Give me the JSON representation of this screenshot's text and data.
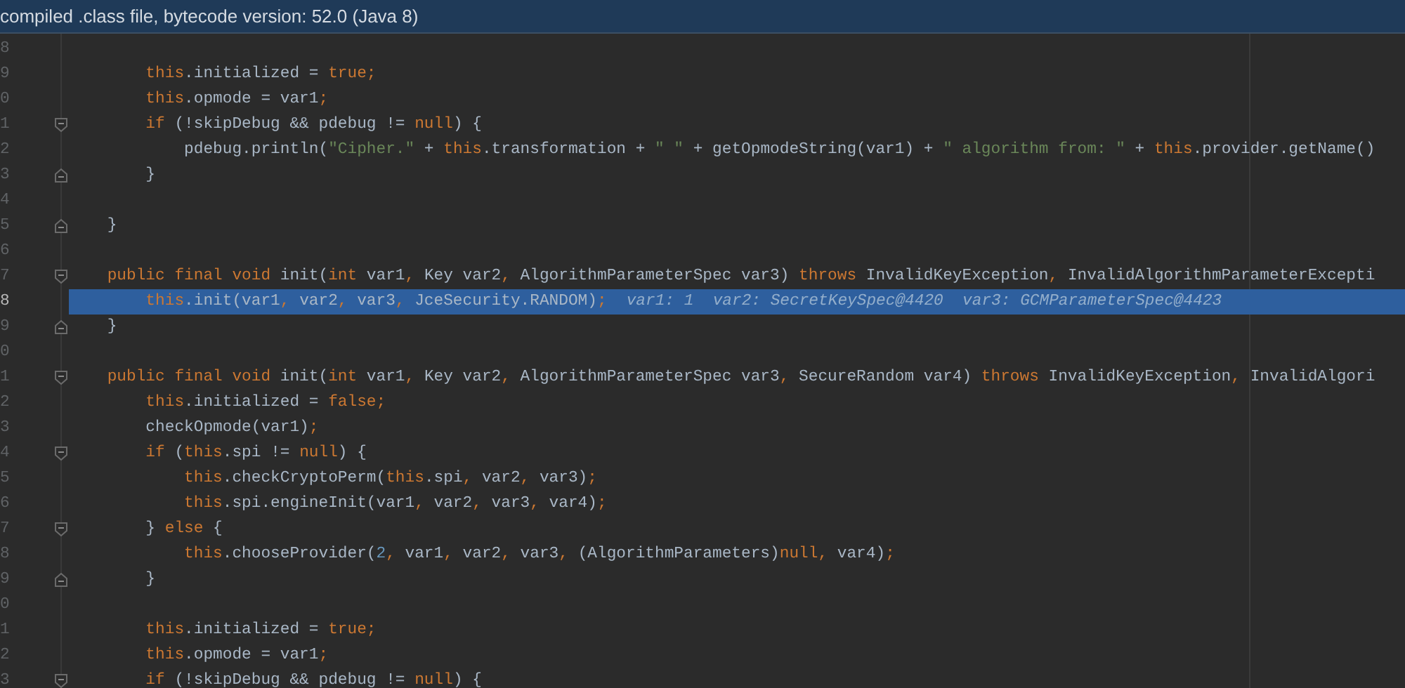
{
  "title_bar": {
    "text": "compiled .class file, bytecode version: 52.0 (Java 8)"
  },
  "lines": [
    {
      "number": "8",
      "selected": false
    },
    {
      "number": "9",
      "selected": false,
      "tokens": [
        {
          "kind": "kw",
          "text": "        this"
        },
        {
          "kind": "plain",
          "text": ".initialized = "
        },
        {
          "kind": "kw",
          "text": "true;"
        }
      ]
    },
    {
      "number": "0",
      "selected": false,
      "tokens": [
        {
          "kind": "kw",
          "text": "        this"
        },
        {
          "kind": "plain",
          "text": ".opmode = var1"
        },
        {
          "kind": "kw",
          "text": ";"
        }
      ]
    },
    {
      "number": "1",
      "selected": false,
      "fold": {
        "kind": "open"
      },
      "tokens": [
        {
          "kind": "kw",
          "text": "        if"
        },
        {
          "kind": "plain",
          "text": " (!skipDebug && pdebug != "
        },
        {
          "kind": "kw",
          "text": "null"
        },
        {
          "kind": "plain",
          "text": ") {"
        }
      ]
    },
    {
      "number": "2",
      "selected": false,
      "tokens": [
        {
          "kind": "plain",
          "text": "            pdebug.println("
        },
        {
          "kind": "str",
          "text": "\"Cipher.\""
        },
        {
          "kind": "plain",
          "text": " + "
        },
        {
          "kind": "kw",
          "text": "this"
        },
        {
          "kind": "plain",
          "text": ".transformation + "
        },
        {
          "kind": "str",
          "text": "\" \""
        },
        {
          "kind": "plain",
          "text": " + getOpmodeString(var1) + "
        },
        {
          "kind": "str",
          "text": "\" algorithm from: \""
        },
        {
          "kind": "plain",
          "text": " + "
        },
        {
          "kind": "kw",
          "text": "this"
        },
        {
          "kind": "plain",
          "text": ".provider.getName()"
        }
      ]
    },
    {
      "number": "3",
      "selected": false,
      "fold": {
        "kind": "close"
      },
      "tokens": [
        {
          "kind": "plain",
          "text": "        }"
        }
      ]
    },
    {
      "number": "4",
      "selected": false
    },
    {
      "number": "5",
      "selected": false,
      "fold": {
        "kind": "close"
      },
      "tokens": [
        {
          "kind": "plain",
          "text": "    }"
        }
      ]
    },
    {
      "number": "6",
      "selected": false
    },
    {
      "number": "7",
      "selected": false,
      "fold": {
        "kind": "open"
      },
      "tokens": [
        {
          "kind": "kw",
          "text": "    public final void "
        },
        {
          "kind": "plain",
          "text": "init("
        },
        {
          "kind": "kw",
          "text": "int "
        },
        {
          "kind": "plain",
          "text": "var1"
        },
        {
          "kind": "kw",
          "text": ", "
        },
        {
          "kind": "plain",
          "text": "Key var2"
        },
        {
          "kind": "kw",
          "text": ", "
        },
        {
          "kind": "plain",
          "text": "AlgorithmParameterSpec var3) "
        },
        {
          "kind": "kw",
          "text": "throws "
        },
        {
          "kind": "plain",
          "text": "InvalidKeyException"
        },
        {
          "kind": "kw",
          "text": ", "
        },
        {
          "kind": "plain",
          "text": "InvalidAlgorithmParameterExcepti"
        }
      ]
    },
    {
      "number": "8",
      "selected": true,
      "tokens": [
        {
          "kind": "kw",
          "text": "        this"
        },
        {
          "kind": "plain",
          "text": ".init(var1"
        },
        {
          "kind": "kw",
          "text": ", "
        },
        {
          "kind": "plain",
          "text": "var2"
        },
        {
          "kind": "kw",
          "text": ", "
        },
        {
          "kind": "plain",
          "text": "var3"
        },
        {
          "kind": "kw",
          "text": ", "
        },
        {
          "kind": "plain",
          "text": "JceSecurity.RANDOM)"
        },
        {
          "kind": "kw",
          "text": ";"
        }
      ],
      "inline_values": "var1: 1  var2: SecretKeySpec@4420  var3: GCMParameterSpec@4423"
    },
    {
      "number": "9",
      "selected": false,
      "fold": {
        "kind": "close"
      },
      "tokens": [
        {
          "kind": "plain",
          "text": "    }"
        }
      ]
    },
    {
      "number": "0",
      "selected": false
    },
    {
      "number": "1",
      "selected": false,
      "fold": {
        "kind": "open"
      },
      "tokens": [
        {
          "kind": "kw",
          "text": "    public final void "
        },
        {
          "kind": "plain",
          "text": "init("
        },
        {
          "kind": "kw",
          "text": "int "
        },
        {
          "kind": "plain",
          "text": "var1"
        },
        {
          "kind": "kw",
          "text": ", "
        },
        {
          "kind": "plain",
          "text": "Key var2"
        },
        {
          "kind": "kw",
          "text": ", "
        },
        {
          "kind": "plain",
          "text": "AlgorithmParameterSpec var3"
        },
        {
          "kind": "kw",
          "text": ", "
        },
        {
          "kind": "plain",
          "text": "SecureRandom var4) "
        },
        {
          "kind": "kw",
          "text": "throws "
        },
        {
          "kind": "plain",
          "text": "InvalidKeyException"
        },
        {
          "kind": "kw",
          "text": ", "
        },
        {
          "kind": "plain",
          "text": "InvalidAlgori"
        }
      ]
    },
    {
      "number": "2",
      "selected": false,
      "tokens": [
        {
          "kind": "kw",
          "text": "        this"
        },
        {
          "kind": "plain",
          "text": ".initialized = "
        },
        {
          "kind": "kw",
          "text": "false;"
        }
      ]
    },
    {
      "number": "3",
      "selected": false,
      "tokens": [
        {
          "kind": "plain",
          "text": "        checkOpmode(var1)"
        },
        {
          "kind": "kw",
          "text": ";"
        }
      ]
    },
    {
      "number": "4",
      "selected": false,
      "fold": {
        "kind": "open"
      },
      "tokens": [
        {
          "kind": "kw",
          "text": "        if "
        },
        {
          "kind": "plain",
          "text": "("
        },
        {
          "kind": "kw",
          "text": "this"
        },
        {
          "kind": "plain",
          "text": ".spi != "
        },
        {
          "kind": "kw",
          "text": "null"
        },
        {
          "kind": "plain",
          "text": ") {"
        }
      ]
    },
    {
      "number": "5",
      "selected": false,
      "tokens": [
        {
          "kind": "kw",
          "text": "            this"
        },
        {
          "kind": "plain",
          "text": ".checkCryptoPerm("
        },
        {
          "kind": "kw",
          "text": "this"
        },
        {
          "kind": "plain",
          "text": ".spi"
        },
        {
          "kind": "kw",
          "text": ", "
        },
        {
          "kind": "plain",
          "text": "var2"
        },
        {
          "kind": "kw",
          "text": ", "
        },
        {
          "kind": "plain",
          "text": "var3)"
        },
        {
          "kind": "kw",
          "text": ";"
        }
      ]
    },
    {
      "number": "6",
      "selected": false,
      "tokens": [
        {
          "kind": "kw",
          "text": "            this"
        },
        {
          "kind": "plain",
          "text": ".spi.engineInit(var1"
        },
        {
          "kind": "kw",
          "text": ", "
        },
        {
          "kind": "plain",
          "text": "var2"
        },
        {
          "kind": "kw",
          "text": ", "
        },
        {
          "kind": "plain",
          "text": "var3"
        },
        {
          "kind": "kw",
          "text": ", "
        },
        {
          "kind": "plain",
          "text": "var4)"
        },
        {
          "kind": "kw",
          "text": ";"
        }
      ]
    },
    {
      "number": "7",
      "selected": false,
      "fold": {
        "kind": "open"
      },
      "tokens": [
        {
          "kind": "plain",
          "text": "        } "
        },
        {
          "kind": "kw",
          "text": "else "
        },
        {
          "kind": "plain",
          "text": "{"
        }
      ]
    },
    {
      "number": "8",
      "selected": false,
      "tokens": [
        {
          "kind": "kw",
          "text": "            this"
        },
        {
          "kind": "plain",
          "text": ".chooseProvider("
        },
        {
          "kind": "num",
          "text": "2"
        },
        {
          "kind": "kw",
          "text": ", "
        },
        {
          "kind": "plain",
          "text": "var1"
        },
        {
          "kind": "kw",
          "text": ", "
        },
        {
          "kind": "plain",
          "text": "var2"
        },
        {
          "kind": "kw",
          "text": ", "
        },
        {
          "kind": "plain",
          "text": "var3"
        },
        {
          "kind": "kw",
          "text": ", "
        },
        {
          "kind": "plain",
          "text": "(AlgorithmParameters)"
        },
        {
          "kind": "kw",
          "text": "null"
        },
        {
          "kind": "kw",
          "text": ", "
        },
        {
          "kind": "plain",
          "text": "var4)"
        },
        {
          "kind": "kw",
          "text": ";"
        }
      ]
    },
    {
      "number": "9",
      "selected": false,
      "fold": {
        "kind": "close"
      },
      "tokens": [
        {
          "kind": "plain",
          "text": "        }"
        }
      ]
    },
    {
      "number": "0",
      "selected": false
    },
    {
      "number": "1",
      "selected": false,
      "tokens": [
        {
          "kind": "kw",
          "text": "        this"
        },
        {
          "kind": "plain",
          "text": ".initialized = "
        },
        {
          "kind": "kw",
          "text": "true;"
        }
      ]
    },
    {
      "number": "2",
      "selected": false,
      "tokens": [
        {
          "kind": "kw",
          "text": "        this"
        },
        {
          "kind": "plain",
          "text": ".opmode = var1"
        },
        {
          "kind": "kw",
          "text": ";"
        }
      ]
    },
    {
      "number": "3",
      "selected": false,
      "fold": {
        "kind": "open"
      },
      "tokens": [
        {
          "kind": "kw",
          "text": "        if"
        },
        {
          "kind": "plain",
          "text": " (!skipDebug && pdebug != "
        },
        {
          "kind": "kw",
          "text": "null"
        },
        {
          "kind": "plain",
          "text": ") {"
        }
      ]
    }
  ]
}
